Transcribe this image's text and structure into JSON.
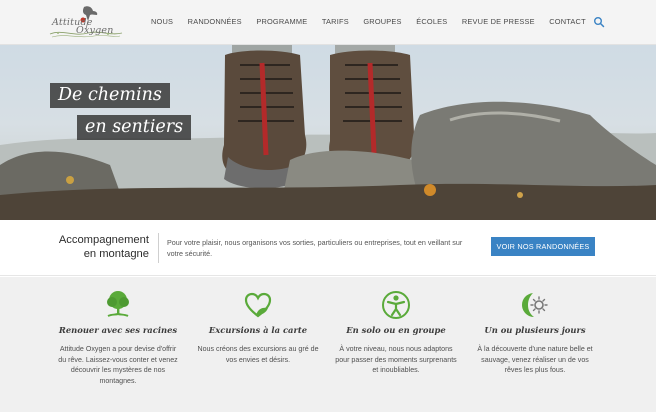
{
  "header": {
    "logo": {
      "line1": "Attitude",
      "line2": "Oxygen"
    },
    "nav": [
      "Nous",
      "Randonnées",
      "Programme",
      "Tarifs",
      "Groupes",
      "Écoles",
      "Revue de presse",
      "Contact"
    ],
    "search_icon": "search-icon"
  },
  "hero": {
    "tag_line1": "De chemins",
    "tag_line2": "en sentiers"
  },
  "intro": {
    "title_line1": "Accompagnement",
    "title_line2": "en montagne",
    "text": "Pour votre plaisir, nous organisons vos sorties, particuliers ou entreprises, tout en veillant sur votre sécurité.",
    "button": "Voir nos randonnées"
  },
  "features": [
    {
      "icon": "tree-icon",
      "title": "Renouer avec ses racines",
      "desc": "Attitude Oxygen a pour devise d'offrir du rêve. Laissez-vous conter et venez découvrir les mystères de nos montagnes."
    },
    {
      "icon": "heart-leaf-icon",
      "title": "Excursions à la carte",
      "desc": "Nous créons des excursions au gré de vos envies et désirs."
    },
    {
      "icon": "group-icon",
      "title": "En solo ou en groupe",
      "desc": "À votre niveau, nous nous adaptons pour passer des moments surprenants et inoubliables."
    },
    {
      "icon": "sun-moon-icon",
      "title": "Un ou plusieurs jours",
      "desc": "À la découverte d'une nature belle et sauvage, venez réaliser un de vos rêves les plus fous."
    }
  ],
  "colors": {
    "accent_blue": "#3a83c4",
    "icon_green": "#5aaa3a",
    "header_bg": "#f4f4f4",
    "features_bg": "#f0f0f0"
  }
}
